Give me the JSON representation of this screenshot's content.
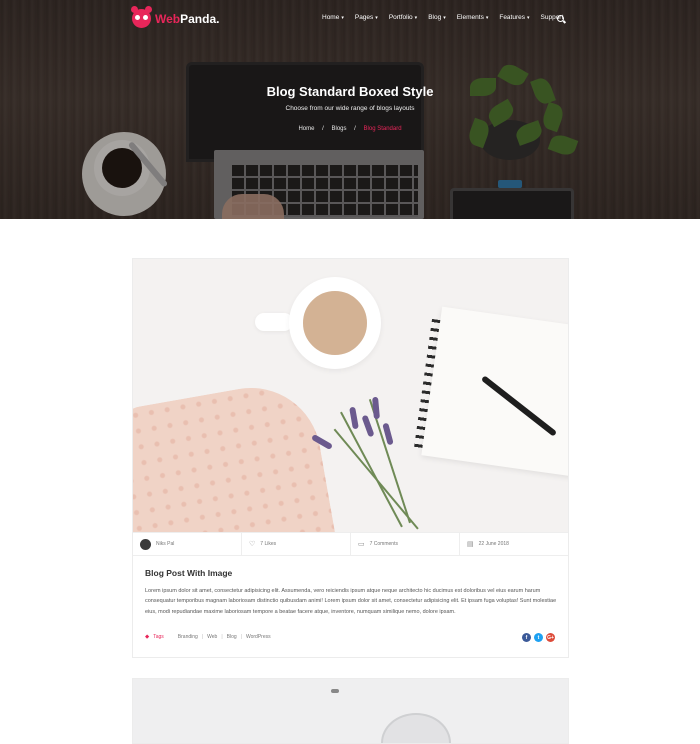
{
  "brand": {
    "name_part1": "Web",
    "name_part2": "Panda."
  },
  "nav": {
    "items": [
      {
        "label": "Home",
        "caret": "▾"
      },
      {
        "label": "Pages",
        "caret": "▾"
      },
      {
        "label": "Portfolio",
        "caret": "▾"
      },
      {
        "label": "Blog",
        "caret": "▾"
      },
      {
        "label": "Elements",
        "caret": "▾"
      },
      {
        "label": "Features",
        "caret": "▾"
      },
      {
        "label": "Support",
        "caret": ""
      }
    ],
    "search_icon": "search-icon"
  },
  "hero": {
    "title": "Blog Standard Boxed Style",
    "subtitle": "Choose from our wide range of blogs layouts",
    "breadcrumb": [
      "Home",
      "Blogs",
      "Blog Standard"
    ],
    "breadcrumb_sep": "/"
  },
  "post": {
    "author": "Niks Pal",
    "likes": "7 Likes",
    "comments": "7 Comments",
    "date": "22 June 2018",
    "title": "Blog Post With Image",
    "body": "Lorem ipsum dolor sit amet, consectetur adipisicing elit. Assumenda, vero reiciendis ipsum atque neque architecto hic ducimus est doloribus vel eius earum harum consequatur temporibus magnam laboriosam distinctio quibusdam animi! Lorem ipsum dolor sit amet, consectetur adipisicing elit. Et ipsam fuga voluptas! Sunt molestiae eius, modi repudiandae maxime laboriosam tempore a beatae facere atque, inventore, numquam similique nemo, dolore ipsam.",
    "tags_label": "Tags",
    "tags": [
      "Branding",
      "Web",
      "Blog",
      "WordPress"
    ],
    "tag_sep": "|",
    "share": {
      "facebook": "f",
      "twitter": "t",
      "google": "G+"
    }
  },
  "colors": {
    "accent": "#e8265a",
    "facebook": "#3b5998",
    "twitter": "#1da1f2",
    "google": "#dd4b39"
  }
}
